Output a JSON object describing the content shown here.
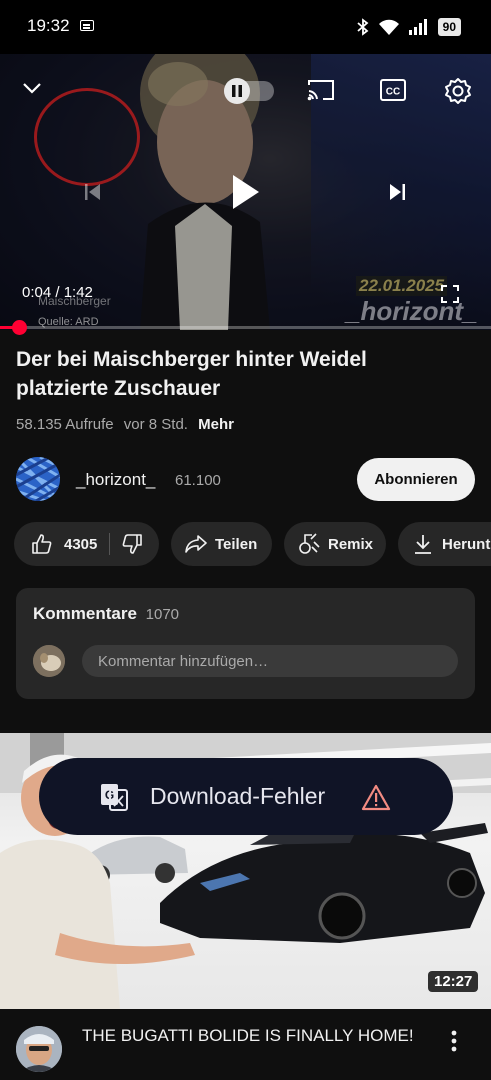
{
  "status_bar": {
    "time": "19:32",
    "battery": "90"
  },
  "player": {
    "time_current": "0:04",
    "time_total": "1:42",
    "time_label": "0:04 / 1:42",
    "progress": 0.04,
    "overlay_date": "22.01.2025",
    "overlay_brand": "_horizont_",
    "overlay_show": "Maischberger",
    "overlay_source": "Quelle: ARD"
  },
  "video": {
    "title": "Der bei Maischberger hinter Weidel platzierte Zuschauer",
    "views": "58.135 Aufrufe",
    "age": "vor 8 Std.",
    "more": "Mehr"
  },
  "channel": {
    "name": "_horizont_",
    "subscribers": "61.100",
    "subscribe_label": "Abonnieren"
  },
  "actions": {
    "likes": "4305",
    "share": "Teilen",
    "remix": "Remix",
    "download": "Herunterladen"
  },
  "comments": {
    "title": "Kommentare",
    "count": "1070",
    "placeholder": "Kommentar hinzufügen…"
  },
  "toast": {
    "message": "Download-Fehler"
  },
  "next_video": {
    "duration": "12:27",
    "title": "THE BUGATTI BOLIDE IS FINALLY HOME!"
  },
  "colors": {
    "accent": "#ff0033",
    "background": "#0f0f0f",
    "surface": "#272727"
  }
}
